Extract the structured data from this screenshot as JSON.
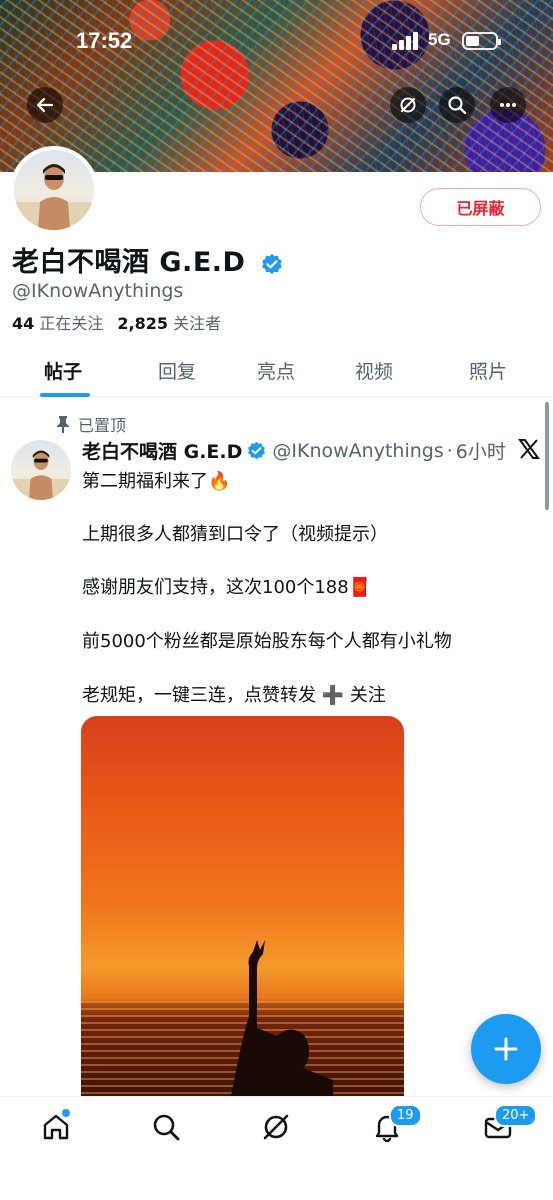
{
  "status_bar": {
    "time": "17:52",
    "network": "5G"
  },
  "profile": {
    "display_name": "老白不喝酒 G.E.D",
    "handle": "@IKnowAnythings",
    "following_count": "44",
    "following_label": "正在关注",
    "followers_count": "2,825",
    "followers_label": "关注者",
    "blocked_button_label": "已屏蔽"
  },
  "tabs": [
    {
      "label": "帖子",
      "active": true
    },
    {
      "label": "回复"
    },
    {
      "label": "亮点"
    },
    {
      "label": "视频"
    },
    {
      "label": "照片"
    }
  ],
  "post": {
    "pinned_label": "已置顶",
    "author_name": "老白不喝酒 G.E.D",
    "author_handle": "@IKnowAnythings",
    "time_ago": "6小时",
    "lines": [
      "第二期福利来了🔥",
      "上期很多人都猜到口令了（视频提示）",
      "感谢朋友们支持，这次100个188🧧",
      "前5000个粉丝都是原始股东每个人都有小礼物",
      "老规矩，一键三连，点赞转发 ➕ 关注"
    ]
  },
  "bottom_nav": {
    "notifications_badge": "19",
    "messages_badge": "20+"
  },
  "colors": {
    "accent": "#1d9bf0",
    "blocked_red": "#f4212e",
    "secondary_text": "#536471"
  }
}
